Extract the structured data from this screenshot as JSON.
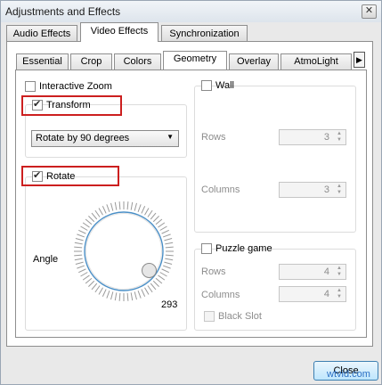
{
  "window": {
    "title": "Adjustments and Effects"
  },
  "tabs": [
    "Audio Effects",
    "Video Effects",
    "Synchronization"
  ],
  "subtabs": [
    "Essential",
    "Crop",
    "Colors",
    "Geometry",
    "Overlay",
    "AtmoLight"
  ],
  "geometry": {
    "interactive_zoom_label": "Interactive Zoom",
    "transform_label": "Transform",
    "transform_select": "Rotate by 90 degrees",
    "rotate_label": "Rotate",
    "angle_label": "Angle",
    "angle_value": "293"
  },
  "wall": {
    "label": "Wall",
    "rows_label": "Rows",
    "rows_value": "3",
    "columns_label": "Columns",
    "columns_value": "3"
  },
  "puzzle": {
    "label": "Puzzle game",
    "rows_label": "Rows",
    "rows_value": "4",
    "columns_label": "Columns",
    "columns_value": "4",
    "black_slot_label": "Black Slot"
  },
  "footer": {
    "close_label": "Close",
    "watermark": "wtvid.com"
  },
  "colors": {
    "highlight": "#cc1f1f",
    "dial_ring": "#4a8fc7"
  }
}
